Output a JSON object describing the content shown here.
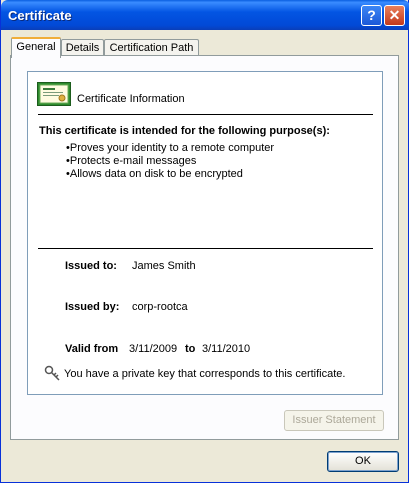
{
  "window": {
    "title": "Certificate"
  },
  "titlebar": {
    "help_glyph": "?",
    "close_glyph": "✕"
  },
  "tabs": [
    {
      "label": "General",
      "active": true
    },
    {
      "label": "Details",
      "active": false
    },
    {
      "label": "Certification Path",
      "active": false
    }
  ],
  "info": {
    "heading": "Certificate Information",
    "purpose_title": "This certificate is intended for the following purpose(s):",
    "purposes": [
      "•Proves your identity to a remote computer",
      "•Protects e-mail messages",
      "•Allows data on disk to be encrypted"
    ],
    "issued_to_label": "Issued to:",
    "issued_to_value": "James Smith",
    "issued_by_label": "Issued by:",
    "issued_by_value": "corp-rootca",
    "valid_from_label": "Valid from",
    "valid_from_value": "3/11/2009",
    "valid_to_label": "to",
    "valid_to_value": "3/11/2010",
    "private_key_text": "You have a private key that corresponds to this certificate."
  },
  "buttons": {
    "issuer_statement": "Issuer Statement",
    "ok": "OK"
  },
  "icons": {
    "certificate": "certificate-icon",
    "key": "key-icon",
    "help": "help-icon",
    "close": "close-icon"
  },
  "colors": {
    "titlebar": "#0355E3",
    "active_tab_accent": "#F0AE3A",
    "dialog_bg": "#ECE9D8"
  }
}
